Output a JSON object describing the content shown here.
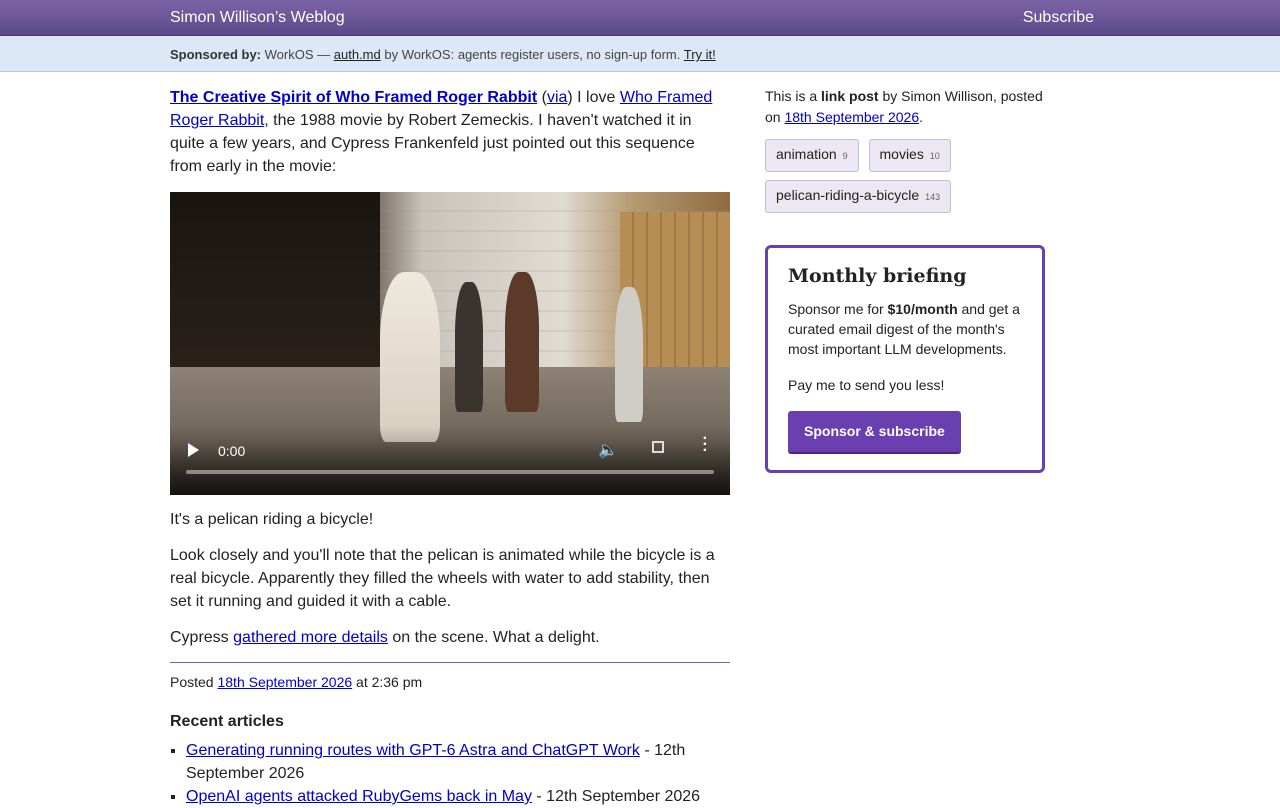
{
  "header": {
    "site_title": "Simon Willison’s Weblog",
    "subscribe_label": "Subscribe"
  },
  "sponsor_bar": {
    "prefix": "Sponsored by:",
    "sponsor_name": "WorkOS —",
    "link_label": "auth.md",
    "text": "by WorkOS: agents register users, no sign-up form.",
    "cta_label": "Try it!"
  },
  "post": {
    "title_link": "The Creative Spirit of Who Framed Roger Rabbit",
    "open_paren": "(",
    "via_label": "via",
    "after_via": ") I love",
    "movie_link": "Who Framed Roger Rabbit",
    "intro_rest": ", the 1988 movie by Robert Zemeckis. I haven't watched it in quite a few years, and Cypress Frankenfeld just pointed out this sequence from early in the movie:",
    "video_time": "0:00",
    "para1": "It's a pelican riding a bicycle!",
    "para2": "Look closely and you'll note that the pelican is animated while the bicycle is a real bicycle. Apparently they filled the wheels with water to add stability, then set it running and guided it with a cable.",
    "para3_prefix": "Cypress",
    "para3_link": "gathered more details",
    "para3_suffix": "on the scene. What a delight.",
    "posted_prefix": "Posted",
    "posted_date": "18th September 2026",
    "posted_time": "at 2:36 pm"
  },
  "recent": {
    "heading": "Recent articles",
    "items": [
      {
        "title": "Generating running routes with GPT-6 Astra and ChatGPT Work",
        "date": "- 12th September 2026"
      },
      {
        "title": "OpenAI agents attacked RubyGems back in May",
        "date": "- 12th September 2026"
      }
    ]
  },
  "sidebar": {
    "meta_prefix": "This is a",
    "meta_type": "link post",
    "meta_by": "by Simon Willison, posted on",
    "meta_date": "18th September 2026",
    "meta_end": ".",
    "tags": [
      {
        "name": "animation",
        "count": "9"
      },
      {
        "name": "movies",
        "count": "10"
      },
      {
        "name": "pelican-riding-a-bicycle",
        "count": "143"
      }
    ],
    "briefing": {
      "title": "Monthly briefing",
      "text_prefix": "Sponsor me for",
      "price": "$10/month",
      "text_suffix": "and get a curated email digest of the month's most important LLM developments.",
      "tagline": "Pay me to send you less!",
      "button_label": "Sponsor & subscribe"
    }
  },
  "colors": {
    "topbar": "#6b579a",
    "sponsor_bg": "#dde8f6",
    "accent": "#6a3fb0",
    "link": "#0000cc"
  }
}
